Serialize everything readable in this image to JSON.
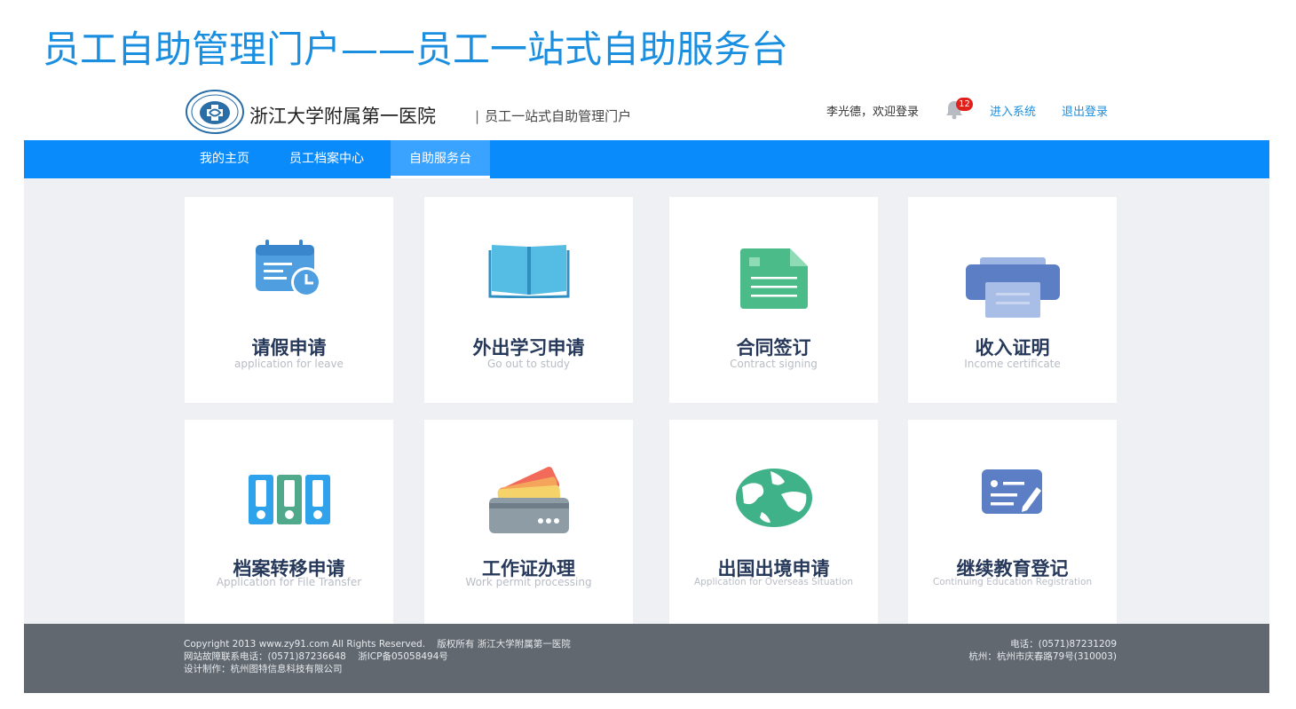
{
  "slide_title": "员工自助管理门户——员工一站式自助服务台",
  "header": {
    "hospital_name": "浙江大学附属第一医院",
    "separator": "|",
    "portal_name": "员工一站式自助管理门户",
    "welcome": "李光德，欢迎登录",
    "notification_count": "12",
    "enter_system": "进入系统",
    "logout": "退出登录"
  },
  "nav": {
    "items": [
      {
        "label": "我的主页",
        "active": false
      },
      {
        "label": "员工档案中心",
        "active": false
      },
      {
        "label": "自助服务台",
        "active": true
      }
    ]
  },
  "cards": [
    {
      "cn": "请假申请",
      "en": "application for leave",
      "icon": "calendar-clock-icon"
    },
    {
      "cn": "外出学习申请",
      "en": "Go out to study",
      "icon": "open-book-icon"
    },
    {
      "cn": "合同签订",
      "en": "Contract signing",
      "icon": "contract-document-icon"
    },
    {
      "cn": "收入证明",
      "en": "Income certificate",
      "icon": "printer-icon"
    },
    {
      "cn": "档案转移申请",
      "en": "Application for File Transfer",
      "icon": "binders-icon"
    },
    {
      "cn": "工作证办理",
      "en": "Work permit processing",
      "icon": "cards-wallet-icon"
    },
    {
      "cn": "出国出境申请",
      "en": "Application for Overseas Situation",
      "icon": "globe-icon"
    },
    {
      "cn": "继续教育登记",
      "en": "Continuing Education Registration",
      "icon": "edit-form-icon"
    }
  ],
  "footer": {
    "left": [
      "Copyright 2013 www.zy91.com All Rights Reserved.    版权所有 浙江大学附属第一医院",
      "网站故障联系电话：(0571)87236648    浙ICP备05058494号",
      "设计制作：杭州图特信息科技有限公司"
    ],
    "right": [
      "电话：(0571)87231209",
      "杭州：杭州市庆春路79号(310003)"
    ]
  },
  "colors": {
    "title_blue": "#1a8fe0",
    "nav_blue": "#0a8bfc",
    "footer_gray": "#616870",
    "card_title": "#27395a"
  }
}
